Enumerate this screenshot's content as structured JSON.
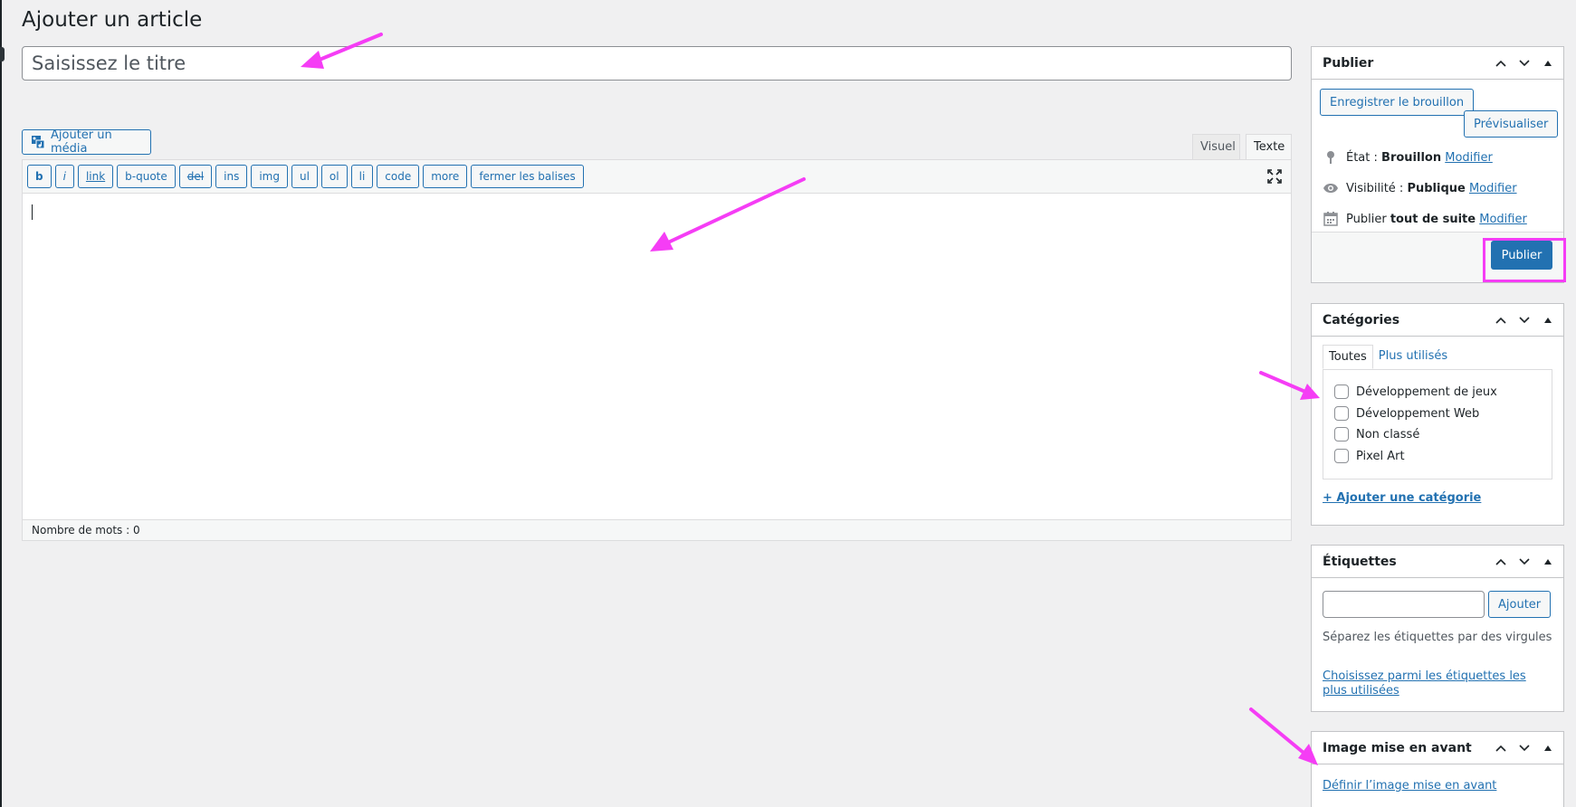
{
  "page": {
    "title": "Ajouter un article"
  },
  "post_title": {
    "placeholder": "Saisissez le titre"
  },
  "media": {
    "button_label": "Ajouter un média"
  },
  "editor": {
    "tabs": [
      "Visuel",
      "Texte"
    ],
    "active_tab": "Texte",
    "quicktags": [
      "b",
      "i",
      "link",
      "b-quote",
      "del",
      "ins",
      "img",
      "ul",
      "ol",
      "li",
      "code",
      "more",
      "fermer les balises"
    ],
    "word_count": "Nombre de mots : 0"
  },
  "publish_box": {
    "title": "Publier",
    "save_draft": "Enregistrer le brouillon",
    "preview": "Prévisualiser",
    "status_label": "État : ",
    "status_value": "Brouillon",
    "visibility_label": "Visibilité : ",
    "visibility_value": "Publique",
    "schedule_label": "Publier ",
    "schedule_value": "tout de suite",
    "edit_link": "Modifier",
    "publish_button": "Publier"
  },
  "categories_box": {
    "title": "Catégories",
    "tabs": [
      "Toutes",
      "Plus utilisés"
    ],
    "items": [
      "Développement de jeux",
      "Développement Web",
      "Non classé",
      "Pixel Art"
    ],
    "add_link": "+ Ajouter une catégorie"
  },
  "tags_box": {
    "title": "Étiquettes",
    "add_button": "Ajouter",
    "hint": "Séparez les étiquettes par des virgules",
    "choose_link": "Choisissez parmi les étiquettes les plus utilisées"
  },
  "featured_image_box": {
    "title": "Image mise en avant",
    "set_link": "Définir l’image mise en avant"
  },
  "colors": {
    "accent": "#2271b1",
    "annotation": "#f53df5"
  }
}
